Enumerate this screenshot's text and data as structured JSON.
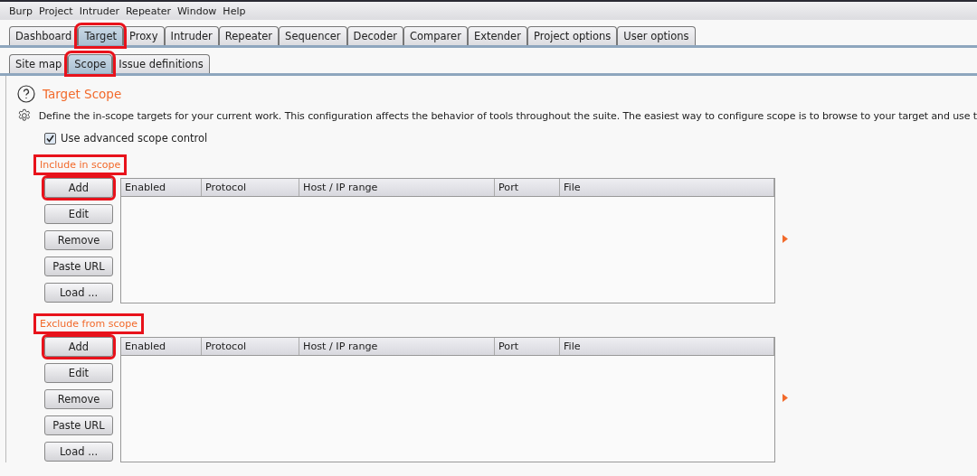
{
  "menu": [
    "Burp",
    "Project",
    "Intruder",
    "Repeater",
    "Window",
    "Help"
  ],
  "tabs": [
    {
      "label": "Dashboard",
      "selected": false,
      "highlighted": false
    },
    {
      "label": "Target",
      "selected": true,
      "highlighted": true
    },
    {
      "label": "Proxy",
      "selected": false,
      "highlighted": false
    },
    {
      "label": "Intruder",
      "selected": false,
      "highlighted": false
    },
    {
      "label": "Repeater",
      "selected": false,
      "highlighted": false
    },
    {
      "label": "Sequencer",
      "selected": false,
      "highlighted": false
    },
    {
      "label": "Decoder",
      "selected": false,
      "highlighted": false
    },
    {
      "label": "Comparer",
      "selected": false,
      "highlighted": false
    },
    {
      "label": "Extender",
      "selected": false,
      "highlighted": false
    },
    {
      "label": "Project options",
      "selected": false,
      "highlighted": false
    },
    {
      "label": "User options",
      "selected": false,
      "highlighted": false
    }
  ],
  "subtabs": [
    {
      "label": "Site map",
      "selected": false,
      "highlighted": false
    },
    {
      "label": "Scope",
      "selected": true,
      "highlighted": true
    },
    {
      "label": "Issue definitions",
      "selected": false,
      "highlighted": false
    }
  ],
  "panel": {
    "title": "Target Scope",
    "description": "Define the in-scope targets for your current work. This configuration affects the behavior of tools throughout the suite. The easiest way to configure scope is to browse to your target and use t",
    "advanced_scope": {
      "label": "Use advanced scope control",
      "checked": true
    }
  },
  "sections": [
    {
      "title": "Include in scope",
      "highlighted": true,
      "buttons": [
        {
          "label": "Add",
          "highlighted": true
        },
        {
          "label": "Edit",
          "highlighted": false
        },
        {
          "label": "Remove",
          "highlighted": false
        },
        {
          "label": "Paste URL",
          "highlighted": false
        },
        {
          "label": "Load ...",
          "highlighted": false
        }
      ],
      "columns": [
        "Enabled",
        "Protocol",
        "Host / IP range",
        "Port",
        "File"
      ]
    },
    {
      "title": "Exclude from scope",
      "highlighted": true,
      "buttons": [
        {
          "label": "Add",
          "highlighted": true
        },
        {
          "label": "Edit",
          "highlighted": false
        },
        {
          "label": "Remove",
          "highlighted": false
        },
        {
          "label": "Paste URL",
          "highlighted": false
        },
        {
          "label": "Load ...",
          "highlighted": false
        }
      ],
      "columns": [
        "Enabled",
        "Protocol",
        "Host / IP range",
        "Port",
        "File"
      ]
    }
  ]
}
